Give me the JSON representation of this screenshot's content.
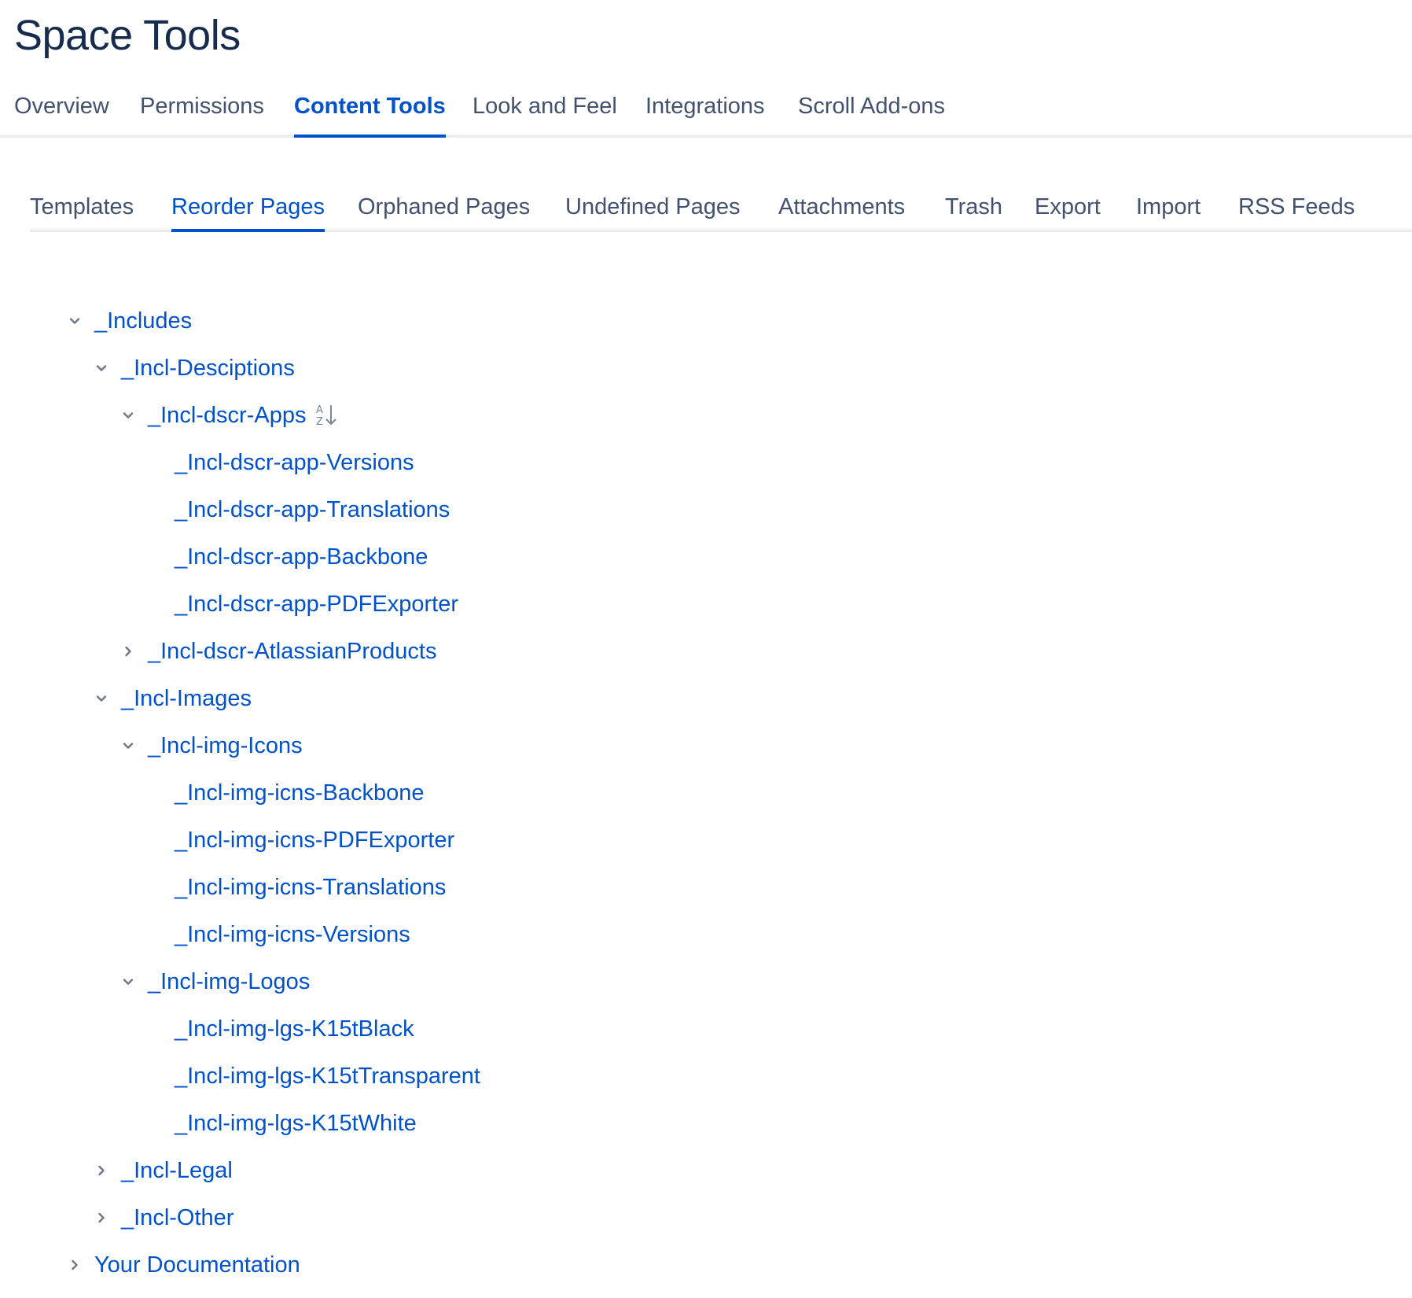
{
  "page": {
    "title": "Space Tools"
  },
  "primary_tabs": [
    {
      "label": "Overview",
      "active": false
    },
    {
      "label": "Permissions",
      "active": false
    },
    {
      "label": "Content Tools",
      "active": true
    },
    {
      "label": "Look and Feel",
      "active": false
    },
    {
      "label": "Integrations",
      "active": false
    },
    {
      "label": "Scroll Add-ons",
      "active": false
    }
  ],
  "secondary_tabs": [
    {
      "label": "Templates",
      "active": false
    },
    {
      "label": "Reorder Pages",
      "active": true
    },
    {
      "label": "Orphaned Pages",
      "active": false
    },
    {
      "label": "Undefined Pages",
      "active": false
    },
    {
      "label": "Attachments",
      "active": false
    },
    {
      "label": "Trash",
      "active": false
    },
    {
      "label": "Export",
      "active": false
    },
    {
      "label": "Import",
      "active": false
    },
    {
      "label": "RSS Feeds",
      "active": false
    }
  ],
  "tree": [
    {
      "label": "_Includes",
      "level": 0,
      "state": "expanded"
    },
    {
      "label": "_Incl-Desciptions",
      "level": 1,
      "state": "expanded"
    },
    {
      "label": "_Incl-dscr-Apps",
      "level": 2,
      "state": "expanded",
      "sort_icon": "sort-alpha-icon"
    },
    {
      "label": "_Incl-dscr-app-Versions",
      "level": 3,
      "state": "leaf"
    },
    {
      "label": "_Incl-dscr-app-Translations",
      "level": 3,
      "state": "leaf"
    },
    {
      "label": "_Incl-dscr-app-Backbone",
      "level": 3,
      "state": "leaf"
    },
    {
      "label": "_Incl-dscr-app-PDFExporter",
      "level": 3,
      "state": "leaf"
    },
    {
      "label": "_Incl-dscr-AtlassianProducts",
      "level": 2,
      "state": "collapsed"
    },
    {
      "label": "_Incl-Images",
      "level": 1,
      "state": "expanded"
    },
    {
      "label": "_Incl-img-Icons",
      "level": 2,
      "state": "expanded"
    },
    {
      "label": "_Incl-img-icns-Backbone",
      "level": 3,
      "state": "leaf"
    },
    {
      "label": "_Incl-img-icns-PDFExporter",
      "level": 3,
      "state": "leaf"
    },
    {
      "label": "_Incl-img-icns-Translations",
      "level": 3,
      "state": "leaf"
    },
    {
      "label": "_Incl-img-icns-Versions",
      "level": 3,
      "state": "leaf"
    },
    {
      "label": "_Incl-img-Logos",
      "level": 2,
      "state": "expanded"
    },
    {
      "label": "_Incl-img-lgs-K15tBlack",
      "level": 3,
      "state": "leaf"
    },
    {
      "label": "_Incl-img-lgs-K15tTransparent",
      "level": 3,
      "state": "leaf"
    },
    {
      "label": "_Incl-img-lgs-K15tWhite",
      "level": 3,
      "state": "leaf"
    },
    {
      "label": "_Incl-Legal",
      "level": 1,
      "state": "collapsed"
    },
    {
      "label": "_Incl-Other",
      "level": 1,
      "state": "collapsed"
    },
    {
      "label": "Your Documentation",
      "level": 0,
      "state": "collapsed"
    }
  ],
  "icons": {
    "expanded": "chevron-down-icon",
    "collapsed": "chevron-right-icon"
  },
  "colors": {
    "link": "#0052cc",
    "title": "#172b4d",
    "tab_text": "#42526e",
    "divider": "#ebecf0",
    "chevron": "#6b778c"
  }
}
